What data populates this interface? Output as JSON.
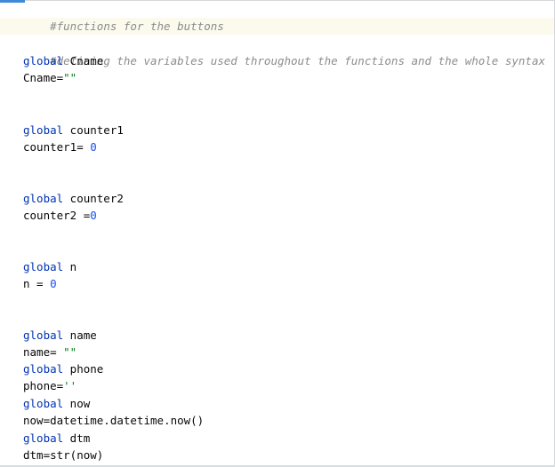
{
  "code": {
    "l1": {
      "comment": "#functions for the buttons"
    },
    "l3": {
      "comment": "#defining the variables used throughout the functions and the whole syntax"
    },
    "l4": {
      "kw": "global",
      "name": " Cname"
    },
    "l5": {
      "name": "Cname=",
      "str": "\"\""
    },
    "l8": {
      "kw": "global",
      "name": " counter1"
    },
    "l9": {
      "name": "counter1= ",
      "num": "0"
    },
    "l12": {
      "kw": "global",
      "name": " counter2"
    },
    "l13": {
      "name": "counter2 =",
      "num": "0"
    },
    "l16": {
      "kw": "global",
      "name": " n"
    },
    "l17": {
      "name": "n = ",
      "num": "0"
    },
    "l20": {
      "kw": "global",
      "name": " name"
    },
    "l21": {
      "name": "name= ",
      "str": "\"\""
    },
    "l22": {
      "kw": "global",
      "name": " phone"
    },
    "l23": {
      "name": "phone=",
      "str": "''"
    },
    "l24": {
      "kw": "global",
      "name": " now"
    },
    "l25": {
      "text": "now=datetime.datetime.now()"
    },
    "l26": {
      "kw": "global",
      "name": " dtm"
    },
    "l27": {
      "text": "dtm=str(now)"
    }
  },
  "colors": {
    "keyword": "#0033b3",
    "number": "#1750eb",
    "string": "#067d17",
    "comment": "#8c8c8c",
    "current_line": "#fcfaed"
  }
}
